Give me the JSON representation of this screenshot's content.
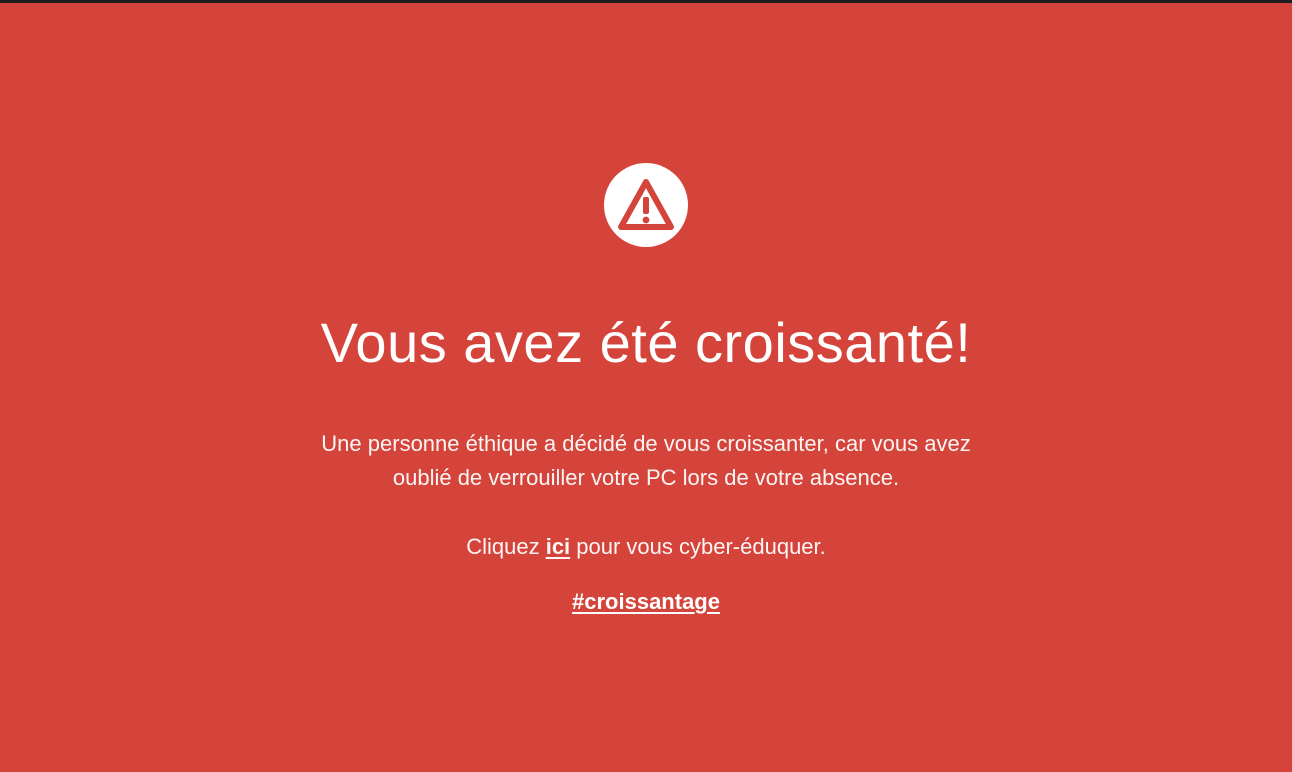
{
  "page": {
    "background_color": "#d4443a",
    "text_color": "#ffffff",
    "icon": "warning-triangle-icon"
  },
  "alert": {
    "title": "Vous avez été croissanté!",
    "message": "Une personne éthique a décidé de vous croissanter, car vous avez oublié de verrouiller votre PC lors de votre absence.",
    "cta_prefix": "Cliquez ",
    "cta_link": "ici",
    "cta_suffix": " pour vous cyber-éduquer.",
    "hashtag": "#croissantage"
  }
}
